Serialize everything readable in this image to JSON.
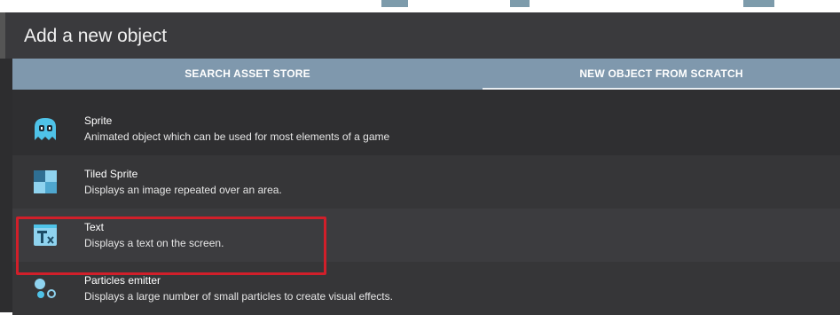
{
  "dialog": {
    "title": "Add a new object"
  },
  "tabs": [
    {
      "label": "SEARCH ASSET STORE",
      "active": false
    },
    {
      "label": "NEW OBJECT FROM SCRATCH",
      "active": true
    }
  ],
  "objects": [
    {
      "name": "Sprite",
      "description": "Animated object which can be used for most elements of a game",
      "icon": "ghost-sprite-icon"
    },
    {
      "name": "Tiled Sprite",
      "description": "Displays an image repeated over an area.",
      "icon": "tiled-sprite-icon"
    },
    {
      "name": "Text",
      "description": "Displays a text on the screen.",
      "icon": "text-object-icon",
      "highlighted": true
    },
    {
      "name": "Particles emitter",
      "description": "Displays a large number of small particles to create visual effects.",
      "icon": "particles-emitter-icon"
    }
  ],
  "colors": {
    "accent": "#7f98ad",
    "highlight_border": "#d11f2a",
    "icon_cyan": "#4fc3e8"
  }
}
